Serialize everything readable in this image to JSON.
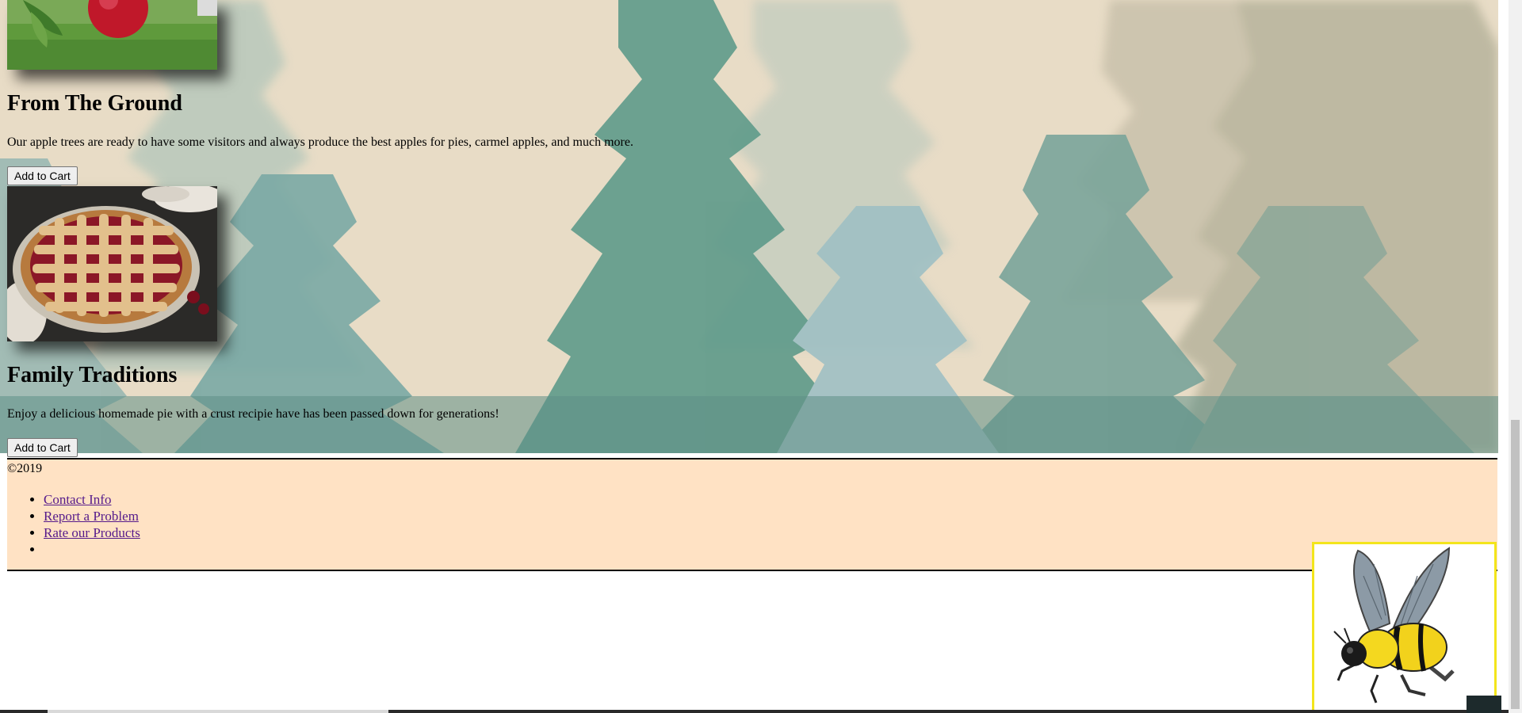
{
  "products": [
    {
      "title": "From The Ground",
      "description": "Our apple trees are ready to have some visitors and always produce the best apples for pies, carmel apples, and much more.",
      "button_label": "Add to Cart"
    },
    {
      "title": "Family Traditions",
      "description": "Enjoy a delicious homemade pie with a crust recipie have has been passed down for generations!",
      "button_label": "Add to Cart"
    }
  ],
  "footer": {
    "copyright": "©2019",
    "links": [
      "Contact Info",
      "Report a Problem",
      "Rate our Products",
      ""
    ]
  },
  "colors": {
    "footer_bg": "#ffe2c4",
    "link": "#551a8b",
    "bee_border": "#f3e51b"
  },
  "icons": {
    "mascot": "bumblebee-image",
    "product_1": "apple-on-grass-image",
    "product_2": "lattice-cherry-pie-image"
  }
}
